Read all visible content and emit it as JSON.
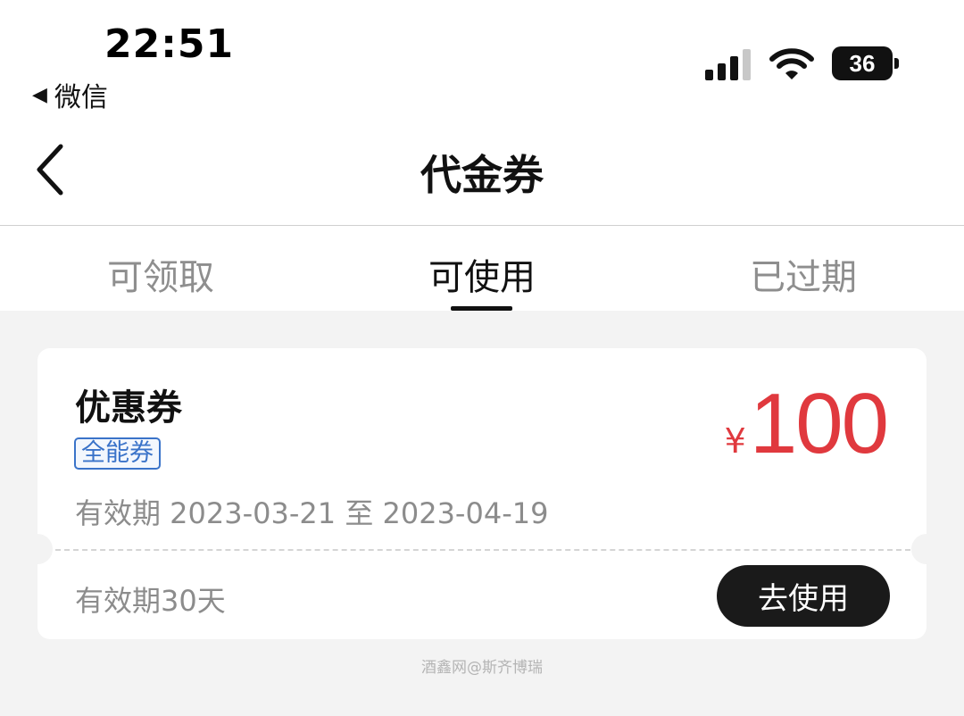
{
  "status_bar": {
    "time": "22:51",
    "back_app": "微信",
    "battery": "36",
    "icons": [
      "cellular-signal-icon",
      "wifi-icon",
      "battery-icon"
    ]
  },
  "nav": {
    "title": "代金券",
    "back_icon": "chevron-left-icon"
  },
  "tabs": [
    {
      "label": "可领取",
      "active": false
    },
    {
      "label": "可使用",
      "active": true
    },
    {
      "label": "已过期",
      "active": false
    }
  ],
  "coupon": {
    "title": "优惠券",
    "tag": "全能券",
    "currency": "¥",
    "amount": "100",
    "validity": "有效期 2023-03-21 至 2023-04-19",
    "duration": "有效期30天",
    "action_label": "去使用"
  },
  "watermark": "酒鑫网@斯齐博瑞",
  "colors": {
    "price_red": "#e0393e",
    "tag_blue": "#3a73c9",
    "button_dark": "#1a1a1a",
    "page_bg": "#f3f3f3"
  }
}
